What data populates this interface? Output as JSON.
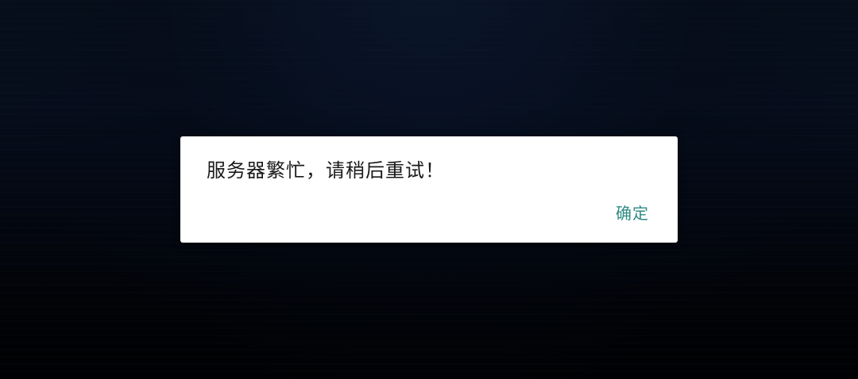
{
  "dialog": {
    "message": "服务器繁忙，请稍后重试！",
    "confirm_label": "确定"
  },
  "colors": {
    "accent": "#2e8b83",
    "background": "#050b18",
    "dialog_bg": "#ffffff",
    "text": "#1a1a1a"
  }
}
